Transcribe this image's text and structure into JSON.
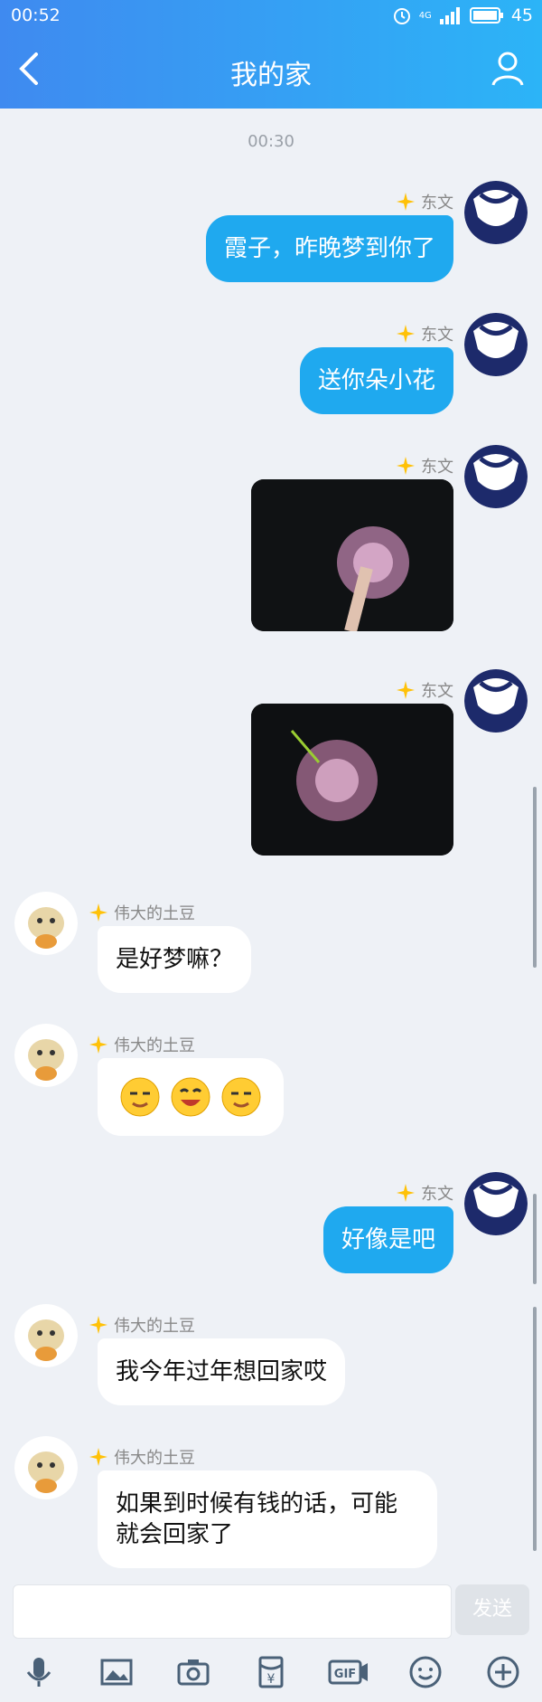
{
  "status_bar": {
    "time": "00:52",
    "network": "4G",
    "battery": "45"
  },
  "header": {
    "title": "我的家"
  },
  "chat": {
    "timestamp": "00:30",
    "messages": [
      {
        "side": "right",
        "name": "东文",
        "type": "text",
        "text": "霞子，昨晚梦到你了"
      },
      {
        "side": "right",
        "name": "东文",
        "type": "text",
        "text": "送你朵小花"
      },
      {
        "side": "right",
        "name": "东文",
        "type": "image"
      },
      {
        "side": "right",
        "name": "东文",
        "type": "image"
      },
      {
        "side": "left",
        "name": "伟大的土豆",
        "type": "text",
        "text": "是好梦嘛？"
      },
      {
        "side": "left",
        "name": "伟大的土豆",
        "type": "emoji"
      },
      {
        "side": "right",
        "name": "东文",
        "type": "text",
        "text": "好像是吧"
      },
      {
        "side": "left",
        "name": "伟大的土豆",
        "type": "text",
        "text": "我今年过年想回家哎"
      },
      {
        "side": "left",
        "name": "伟大的土豆",
        "type": "text",
        "text": "如果到时候有钱的话，可能\n就会回家了"
      }
    ]
  },
  "composer": {
    "send_label": "发送",
    "input_value": ""
  },
  "toolbar_icons": [
    "microphone-icon",
    "image-icon",
    "camera-icon",
    "red-packet-icon",
    "gif-icon",
    "emoji-icon",
    "plus-icon"
  ],
  "colors": {
    "header_start": "#3f8af0",
    "header_end": "#2cb4f7",
    "bubble_out": "#1fa9ef",
    "background": "#eef1f6"
  }
}
